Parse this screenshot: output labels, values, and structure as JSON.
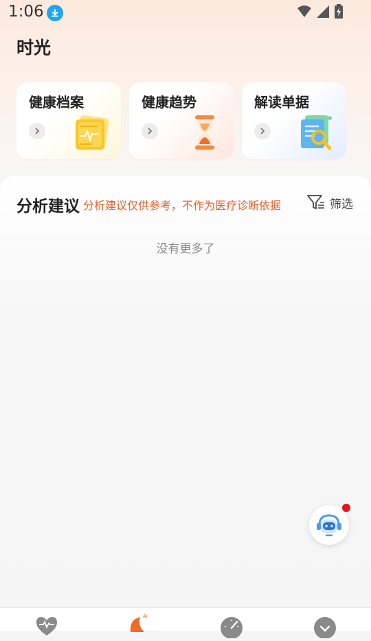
{
  "status_bar": {
    "time": "1:06",
    "icons": [
      "download-icon",
      "wifi-icon",
      "signal-icon",
      "battery-charging-icon"
    ]
  },
  "page": {
    "title": "时光"
  },
  "cards": [
    {
      "title": "健康档案",
      "icon": "health-record-icon",
      "accent": "#f7c21b"
    },
    {
      "title": "健康趋势",
      "icon": "hourglass-icon",
      "accent": "#f27a3a"
    },
    {
      "title": "解读单据",
      "icon": "document-scan-icon",
      "accent": "#3fa0ea"
    }
  ],
  "analysis": {
    "title": "分析建议",
    "disclaimer": "分析建议仅供参考，不作为医疗诊断依据",
    "filter_label": "筛选",
    "empty_text": "没有更多了"
  },
  "colors": {
    "accent": "#e8602c",
    "badge": "#e8141c"
  },
  "bottom_nav": [
    {
      "icon": "heart-pulse-icon"
    },
    {
      "icon": "ai-leaf-icon",
      "badge_text": "Ai",
      "active": true
    },
    {
      "icon": "speedometer-icon"
    },
    {
      "icon": "profile-icon"
    }
  ]
}
